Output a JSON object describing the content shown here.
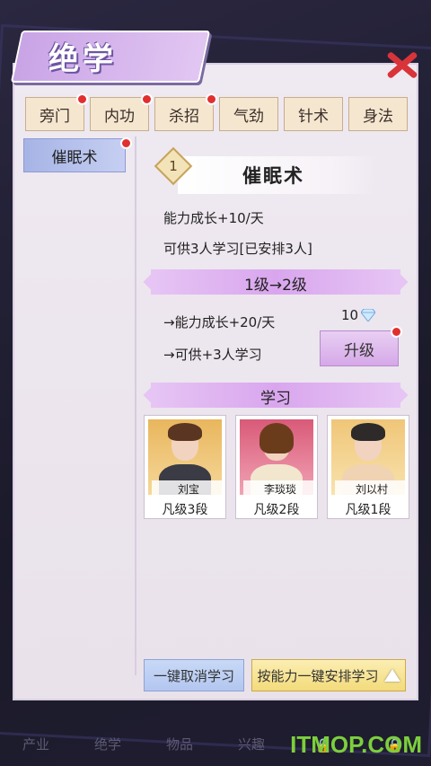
{
  "title": "绝学",
  "tabs": [
    {
      "label": "旁门",
      "badge": true
    },
    {
      "label": "内功",
      "badge": true
    },
    {
      "label": "杀招",
      "badge": true
    },
    {
      "label": "气劲",
      "badge": false
    },
    {
      "label": "针术",
      "badge": false
    },
    {
      "label": "身法",
      "badge": false
    }
  ],
  "skill_list": [
    {
      "label": "催眠术",
      "badge": true
    }
  ],
  "skill_detail": {
    "level_num": "1",
    "name": "催眠术",
    "growth": "能力成长+10/天",
    "capacity": "可供3人学习[已安排3人]",
    "level_up": "1级→2级",
    "next_growth": "→能力成长+20/天",
    "next_capacity": "→可供+3人学习",
    "cost": "10",
    "upgrade_label": "升级"
  },
  "study": {
    "header": "学习",
    "students": [
      {
        "name": "刘宝",
        "rank": "凡级3段"
      },
      {
        "name": "李琰琰",
        "rank": "凡级2段"
      },
      {
        "name": "刘以村",
        "rank": "凡级1段"
      }
    ]
  },
  "buttons": {
    "cancel_all": "一键取消学习",
    "auto_assign": "按能力一键安排学习"
  },
  "bottom_nav": [
    "产业",
    "绝学",
    "物品",
    "兴趣",
    "",
    ""
  ],
  "watermark": "ITMOP.COM",
  "colors": {
    "accent": "#d9a6ee",
    "badge": "#e22e2e",
    "close": "#d8343a"
  }
}
